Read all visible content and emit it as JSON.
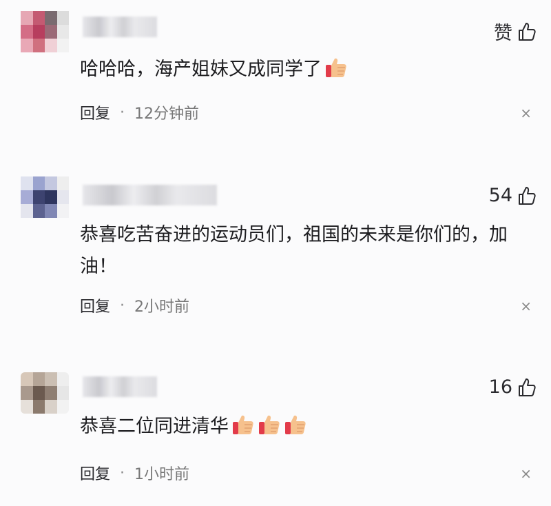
{
  "comments": [
    {
      "like_label": "赞",
      "text": "哈哈哈，海产姐妹又成同学了",
      "reply_label": "回复",
      "separator": "·",
      "time": "12分钟前",
      "thumbs_emoji_count": 1,
      "close_symbol": "×"
    },
    {
      "like_label": "54",
      "text": "恭喜吃苦奋进的运动员们，祖国的未来是你们的，加油！",
      "reply_label": "回复",
      "separator": "·",
      "time": "2小时前",
      "thumbs_emoji_count": 0,
      "close_symbol": "×"
    },
    {
      "like_label": "16",
      "text": "恭喜二位同进清华",
      "reply_label": "回复",
      "separator": "·",
      "time": "1小时前",
      "thumbs_emoji_count": 3,
      "close_symbol": "×"
    }
  ],
  "colors": {
    "background": "#fbfbfc",
    "text": "#1d1d20",
    "meta": "#777777",
    "emoji_cuff": "#e23b4a",
    "emoji_hand": "#f6c18d"
  },
  "icons": {
    "like": "thumbs-up-outline-icon",
    "emoji": "thumbs-up-emoji-icon",
    "close": "close-icon"
  }
}
